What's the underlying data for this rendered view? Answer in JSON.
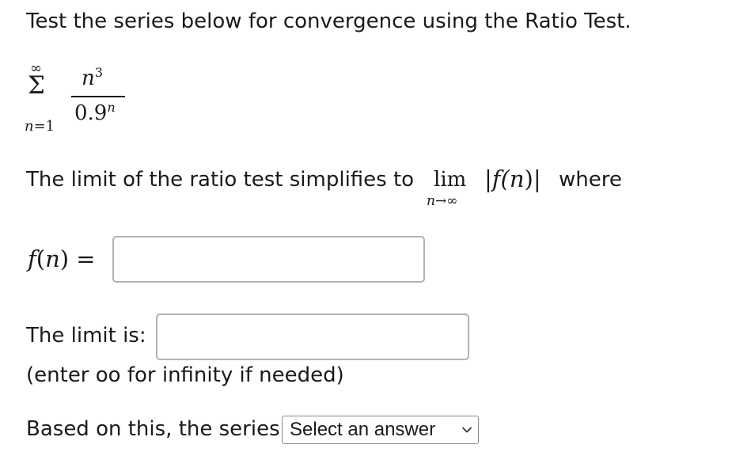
{
  "question": {
    "text": "Test the series below for convergence using the Ratio Test."
  },
  "series": {
    "upper_limit": "∞",
    "sigma": "Σ",
    "lower_var": "n",
    "lower_eq": "=1",
    "numerator_base": "n",
    "numerator_exp": "3",
    "denominator_base": "0.9",
    "denominator_exp": "n"
  },
  "limit_statement": {
    "text": "The limit of the ratio test simplifies to",
    "lim_word": "lim",
    "lim_sub_var": "n",
    "lim_sub_rest": "→∞",
    "expression_open": "|f(",
    "expression_var": "n",
    "expression_close": ")|",
    "where": "where"
  },
  "fn_field": {
    "label_func": "f",
    "label_open": "(",
    "label_var": "n",
    "label_close": ") =",
    "value": ""
  },
  "limit_field": {
    "label": "The limit is:",
    "value": "",
    "hint": "(enter oo for infinity if needed)"
  },
  "conclusion": {
    "label": "Based on this, the series",
    "select_value": "Select an answer",
    "chevron_icon": "chevron-down-icon"
  }
}
